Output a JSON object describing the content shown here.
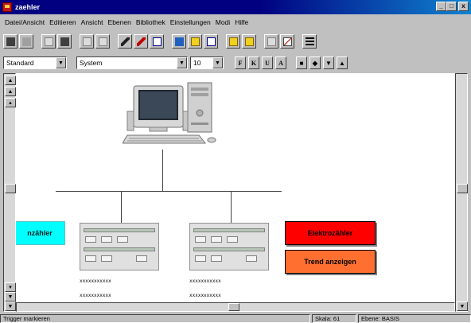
{
  "window": {
    "title": "zaehler"
  },
  "window_buttons": {
    "minimize": "_",
    "maximize": "□",
    "close": "x"
  },
  "menu": [
    "Datei/Ansicht",
    "Editieren",
    "Ansicht",
    "Ebenen",
    "Bibliothek",
    "Einstellungen",
    "Modi",
    "Hilfe"
  ],
  "format_bar": {
    "style_value": "Standard",
    "font_value": "System",
    "size_value": "10",
    "buttons": [
      "F",
      "K",
      "U",
      "A"
    ]
  },
  "diagram": {
    "left_label": "nzähler",
    "right_top_label": "Elektrozähler",
    "right_bottom_label": "Trend anzeigen",
    "panel1_dots": [
      "xxxxxxxxxxx",
      "xxxxxxxxxxx"
    ],
    "panel2_dots": [
      "xxxxxxxxxxx",
      "xxxxxxxxxxx"
    ],
    "colors": {
      "cyan": "#00ffff",
      "red": "#ff0000",
      "orange": "#ff7030"
    }
  },
  "status": {
    "message": "Trigger markieren",
    "scale": "Skala: 61",
    "layer": "Ebene: BASIS"
  },
  "icons": [
    "save-icon",
    "print-icon",
    "cut-icon",
    "copy-icon",
    "paste-icon",
    "connect-icon",
    "disconnect-icon",
    "window-icon",
    "select-icon",
    "zoom-icon",
    "new-icon",
    "open-icon",
    "chart-icon",
    "list-icon"
  ]
}
